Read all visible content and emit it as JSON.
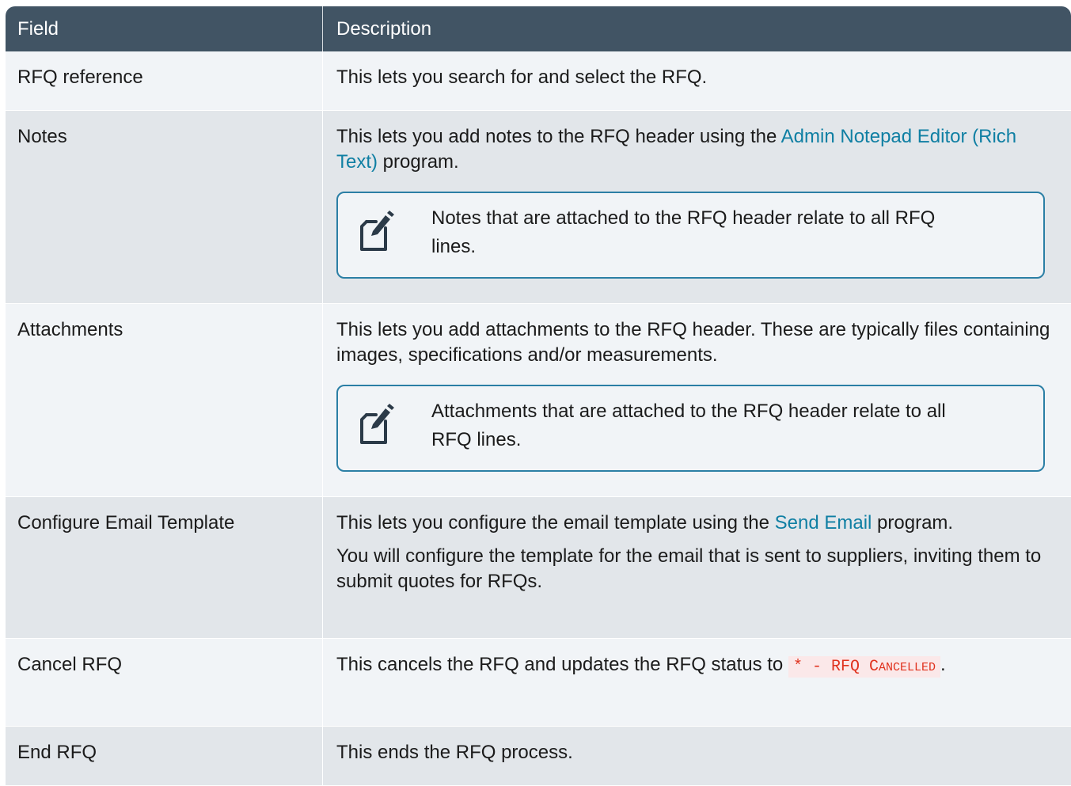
{
  "table": {
    "headers": {
      "field": "Field",
      "description": "Description"
    },
    "rows": [
      {
        "field": "RFQ reference",
        "description": "This lets you search for and select the RFQ."
      },
      {
        "field": "Notes",
        "desc_pre": "This lets you add notes to the RFQ header using the ",
        "desc_link": "Admin Notepad Editor (Rich Text)",
        "desc_post": " program.",
        "note": "Notes that are attached to the RFQ header relate to all RFQ lines."
      },
      {
        "field": "Attachments",
        "description": "This lets you add attachments to the RFQ header. These are typically files containing images, specifications and/or measurements.",
        "note": "Attachments that are attached to the RFQ header relate to all RFQ lines."
      },
      {
        "field": "Configure Email Template",
        "desc_pre": "This lets you configure the email template using the ",
        "desc_link": "Send Email",
        "desc_post": " program.",
        "desc2": "You will configure the template for the email that is sent to suppliers, inviting them to submit quotes for RFQs."
      },
      {
        "field": "Cancel RFQ",
        "desc_pre": "This cancels the RFQ and updates the RFQ status to ",
        "code_a": "* - RFQ ",
        "code_b_cap": "C",
        "code_b_rest": "ANCELLED",
        "desc_post": "."
      },
      {
        "field": "End RFQ",
        "description": "This ends the RFQ process."
      }
    ]
  },
  "colors": {
    "header_bg": "#415464",
    "row_light": "#f1f4f7",
    "row_dark": "#e2e6ea",
    "link": "#0f7fa3",
    "note_border": "#2b7fa5",
    "code_text": "#e0321e"
  },
  "icons": {
    "note": "note-pencil-icon"
  }
}
